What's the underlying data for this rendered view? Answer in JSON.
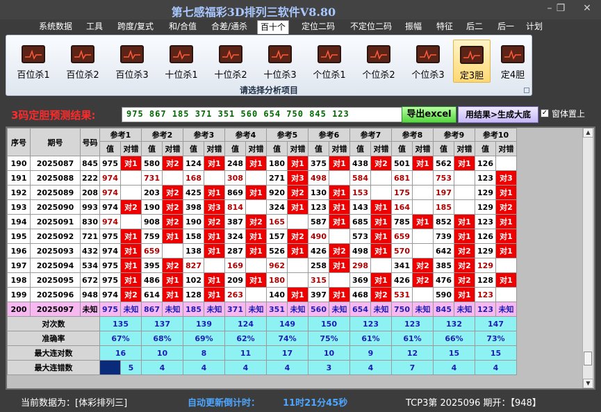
{
  "window": {
    "title": "第七感福彩3D排列三软件V8.80"
  },
  "menu": [
    {
      "label": "系统数据",
      "active": false
    },
    {
      "label": "工具",
      "active": false
    },
    {
      "label": "跨度/复式",
      "active": false
    },
    {
      "label": "和/合值",
      "active": false
    },
    {
      "label": "合差/通杀",
      "active": false
    },
    {
      "label": "百十个",
      "active": true
    },
    {
      "label": "定位二码",
      "active": false
    },
    {
      "label": "不定位二码",
      "active": false
    },
    {
      "label": "振幅",
      "active": false
    },
    {
      "label": "特征",
      "active": false
    },
    {
      "label": "后二",
      "active": false
    },
    {
      "label": "后一",
      "active": false
    },
    {
      "label": "计划",
      "active": false
    }
  ],
  "ribbon": {
    "buttons": [
      {
        "label": "百位杀1",
        "icon": "chart-icon",
        "active": false
      },
      {
        "label": "百位杀2",
        "icon": "chart-icon",
        "active": false
      },
      {
        "label": "百位杀3",
        "icon": "chart-icon",
        "active": false
      },
      {
        "label": "十位杀1",
        "icon": "chart-icon",
        "active": false
      },
      {
        "label": "十位杀2",
        "icon": "chart-icon",
        "active": false
      },
      {
        "label": "十位杀3",
        "icon": "chart-icon",
        "active": false
      },
      {
        "label": "个位杀1",
        "icon": "chart-icon",
        "active": false
      },
      {
        "label": "个位杀2",
        "icon": "chart-icon",
        "active": false
      },
      {
        "label": "个位杀3",
        "icon": "chart-icon",
        "active": false
      },
      {
        "label": "定3胆",
        "icon": "chart-icon",
        "active": true
      },
      {
        "label": "定4胆",
        "icon": "chart-icon",
        "active": false
      }
    ],
    "caption": "请选择分析项目"
  },
  "result": {
    "label": "3码定胆预测结果:",
    "value": "975 867 185 371 351 560 654 750 845 123",
    "excel_button": "导出excel",
    "build_button": "用结果>生成大底",
    "pin_checked": true,
    "pin_label": "窗体置上"
  },
  "table": {
    "headers": {
      "seq": "序号",
      "date": "期号",
      "code": "号码",
      "val": "值",
      "hit": "对错"
    },
    "refs": [
      "参考1",
      "参考2",
      "参考3",
      "参考4",
      "参考5",
      "参考6",
      "参考7",
      "参考8",
      "参考9",
      "参考10"
    ],
    "rows": [
      {
        "seq": "190",
        "date": "2025087",
        "code": "845",
        "cells": [
          [
            "975",
            "对1",
            0
          ],
          [
            "580",
            "对2",
            0
          ],
          [
            "124",
            "对1",
            0
          ],
          [
            "248",
            "对1",
            0
          ],
          [
            "180",
            "对1",
            0
          ],
          [
            "375",
            "对1",
            0
          ],
          [
            "438",
            "对2",
            0
          ],
          [
            "501",
            "对1",
            0
          ],
          [
            "562",
            "对1",
            0
          ],
          [
            "126",
            "",
            0
          ]
        ]
      },
      {
        "seq": "191",
        "date": "2025088",
        "code": "222",
        "cells": [
          [
            "974",
            "",
            1
          ],
          [
            "731",
            "",
            1
          ],
          [
            "168",
            "",
            1
          ],
          [
            "308",
            "",
            1
          ],
          [
            "271",
            "对3",
            0
          ],
          [
            "498",
            "",
            1
          ],
          [
            "584",
            "",
            1
          ],
          [
            "681",
            "",
            1
          ],
          [
            "753",
            "",
            1
          ],
          [
            "123",
            "对3",
            0
          ]
        ]
      },
      {
        "seq": "192",
        "date": "2025089",
        "code": "208",
        "cells": [
          [
            "974",
            "",
            1
          ],
          [
            "203",
            "对2",
            0
          ],
          [
            "425",
            "对1",
            0
          ],
          [
            "869",
            "对1",
            0
          ],
          [
            "920",
            "对2",
            0
          ],
          [
            "130",
            "对1",
            0
          ],
          [
            "153",
            "",
            1
          ],
          [
            "175",
            "",
            1
          ],
          [
            "197",
            "",
            1
          ],
          [
            "129",
            "对1",
            0
          ]
        ]
      },
      {
        "seq": "193",
        "date": "2025090",
        "code": "993",
        "cells": [
          [
            "974",
            "对2",
            0
          ],
          [
            "190",
            "对2",
            0
          ],
          [
            "398",
            "对3",
            0
          ],
          [
            "814",
            "",
            1
          ],
          [
            "324",
            "对1",
            0
          ],
          [
            "123",
            "对1",
            0
          ],
          [
            "143",
            "对1",
            0
          ],
          [
            "164",
            "",
            1
          ],
          [
            "185",
            "",
            1
          ],
          [
            "129",
            "对2",
            0
          ]
        ]
      },
      {
        "seq": "194",
        "date": "2025091",
        "code": "830",
        "cells": [
          [
            "974",
            "",
            1
          ],
          [
            "908",
            "对2",
            0
          ],
          [
            "190",
            "对2",
            0
          ],
          [
            "387",
            "对2",
            0
          ],
          [
            "165",
            "",
            1
          ],
          [
            "587",
            "对1",
            0
          ],
          [
            "685",
            "对1",
            0
          ],
          [
            "785",
            "对1",
            0
          ],
          [
            "852",
            "对1",
            0
          ],
          [
            "123",
            "对1",
            0
          ]
        ]
      },
      {
        "seq": "195",
        "date": "2025092",
        "code": "721",
        "cells": [
          [
            "975",
            "对1",
            0
          ],
          [
            "759",
            "对1",
            0
          ],
          [
            "158",
            "对1",
            0
          ],
          [
            "324",
            "对1",
            0
          ],
          [
            "157",
            "对2",
            0
          ],
          [
            "490",
            "",
            1
          ],
          [
            "573",
            "对1",
            0
          ],
          [
            "659",
            "",
            1
          ],
          [
            "739",
            "对1",
            0
          ],
          [
            "126",
            "对1",
            0
          ]
        ]
      },
      {
        "seq": "196",
        "date": "2025093",
        "code": "432",
        "cells": [
          [
            "974",
            "对1",
            0
          ],
          [
            "659",
            "",
            1
          ],
          [
            "138",
            "对1",
            0
          ],
          [
            "287",
            "对1",
            0
          ],
          [
            "526",
            "对1",
            0
          ],
          [
            "426",
            "对2",
            0
          ],
          [
            "498",
            "对1",
            0
          ],
          [
            "570",
            "",
            1
          ],
          [
            "642",
            "对2",
            0
          ],
          [
            "129",
            "对1",
            0
          ]
        ]
      },
      {
        "seq": "197",
        "date": "2025094",
        "code": "534",
        "cells": [
          [
            "975",
            "对1",
            0
          ],
          [
            "395",
            "对2",
            0
          ],
          [
            "827",
            "",
            1
          ],
          [
            "169",
            "",
            1
          ],
          [
            "962",
            "",
            1
          ],
          [
            "258",
            "对1",
            0
          ],
          [
            "298",
            "",
            1
          ],
          [
            "341",
            "对2",
            0
          ],
          [
            "385",
            "对2",
            0
          ],
          [
            "129",
            "",
            1
          ]
        ]
      },
      {
        "seq": "198",
        "date": "2025095",
        "code": "672",
        "cells": [
          [
            "975",
            "对1",
            0
          ],
          [
            "486",
            "对1",
            0
          ],
          [
            "102",
            "对1",
            0
          ],
          [
            "209",
            "对1",
            0
          ],
          [
            "180",
            "",
            1
          ],
          [
            "315",
            "",
            1
          ],
          [
            "369",
            "对1",
            0
          ],
          [
            "426",
            "对2",
            0
          ],
          [
            "476",
            "对2",
            0
          ],
          [
            "128",
            "对1",
            0
          ]
        ]
      },
      {
        "seq": "199",
        "date": "2025096",
        "code": "948",
        "cells": [
          [
            "974",
            "对2",
            0
          ],
          [
            "614",
            "对1",
            0
          ],
          [
            "128",
            "对1",
            0
          ],
          [
            "263",
            "",
            1
          ],
          [
            "140",
            "对1",
            0
          ],
          [
            "397",
            "对1",
            0
          ],
          [
            "468",
            "对2",
            0
          ],
          [
            "531",
            "",
            1
          ],
          [
            "590",
            "对1",
            0
          ],
          [
            "123",
            "",
            1
          ]
        ]
      }
    ],
    "pending": {
      "seq": "200",
      "date": "2025097",
      "code": "未知",
      "vals": [
        "975",
        "867",
        "185",
        "371",
        "351",
        "560",
        "654",
        "750",
        "845",
        "123"
      ],
      "mark": "未知"
    },
    "stats": [
      {
        "label": "对次数",
        "values": [
          "135",
          "137",
          "139",
          "124",
          "149",
          "150",
          "123",
          "123",
          "132",
          "147"
        ]
      },
      {
        "label": "准确率",
        "values": [
          "67%",
          "68%",
          "69%",
          "62%",
          "74%",
          "75%",
          "61%",
          "61%",
          "66%",
          "73%"
        ]
      },
      {
        "label": "最大连对数",
        "values": [
          "16",
          "10",
          "8",
          "11",
          "17",
          "10",
          "9",
          "12",
          "15",
          "15"
        ]
      },
      {
        "label": "最大连错数",
        "values": [
          "5",
          "4",
          "4",
          "4",
          "4",
          "3",
          "4",
          "7",
          "4",
          "4"
        ]
      }
    ]
  },
  "status": {
    "data_source": "当前数据为：[体彩排列三]",
    "countdown_label": "自动更新倒计时：",
    "countdown_value": "11时21分45秒",
    "draw_info": "TCP3第 2025096 期开：【948】"
  },
  "colors": {
    "hit": "#ee0000",
    "miss_text": "#b00000",
    "pending_row": "#f7b8f2",
    "stat_row": "#8ff2f2",
    "title": "#a9c7ff"
  }
}
